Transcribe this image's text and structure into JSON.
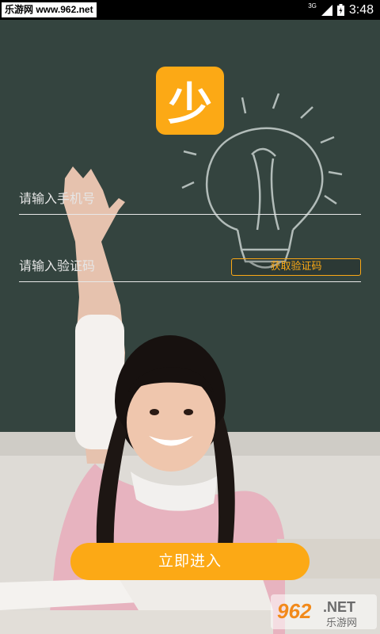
{
  "status_bar": {
    "watermark_text": "乐游网 www.962.net",
    "network": "3G",
    "time": "3:48"
  },
  "logo": {
    "char": "少"
  },
  "login": {
    "phone_placeholder": "请输入手机号",
    "code_placeholder": "请输入验证码",
    "get_code_label": "获取验证码",
    "submit_label": "立即进入"
  },
  "watermark_bottom": {
    "number": "962",
    "suffix": ".NET",
    "name": "乐游网"
  },
  "colors": {
    "accent": "#fca915",
    "chalkboard": "#33433e"
  }
}
